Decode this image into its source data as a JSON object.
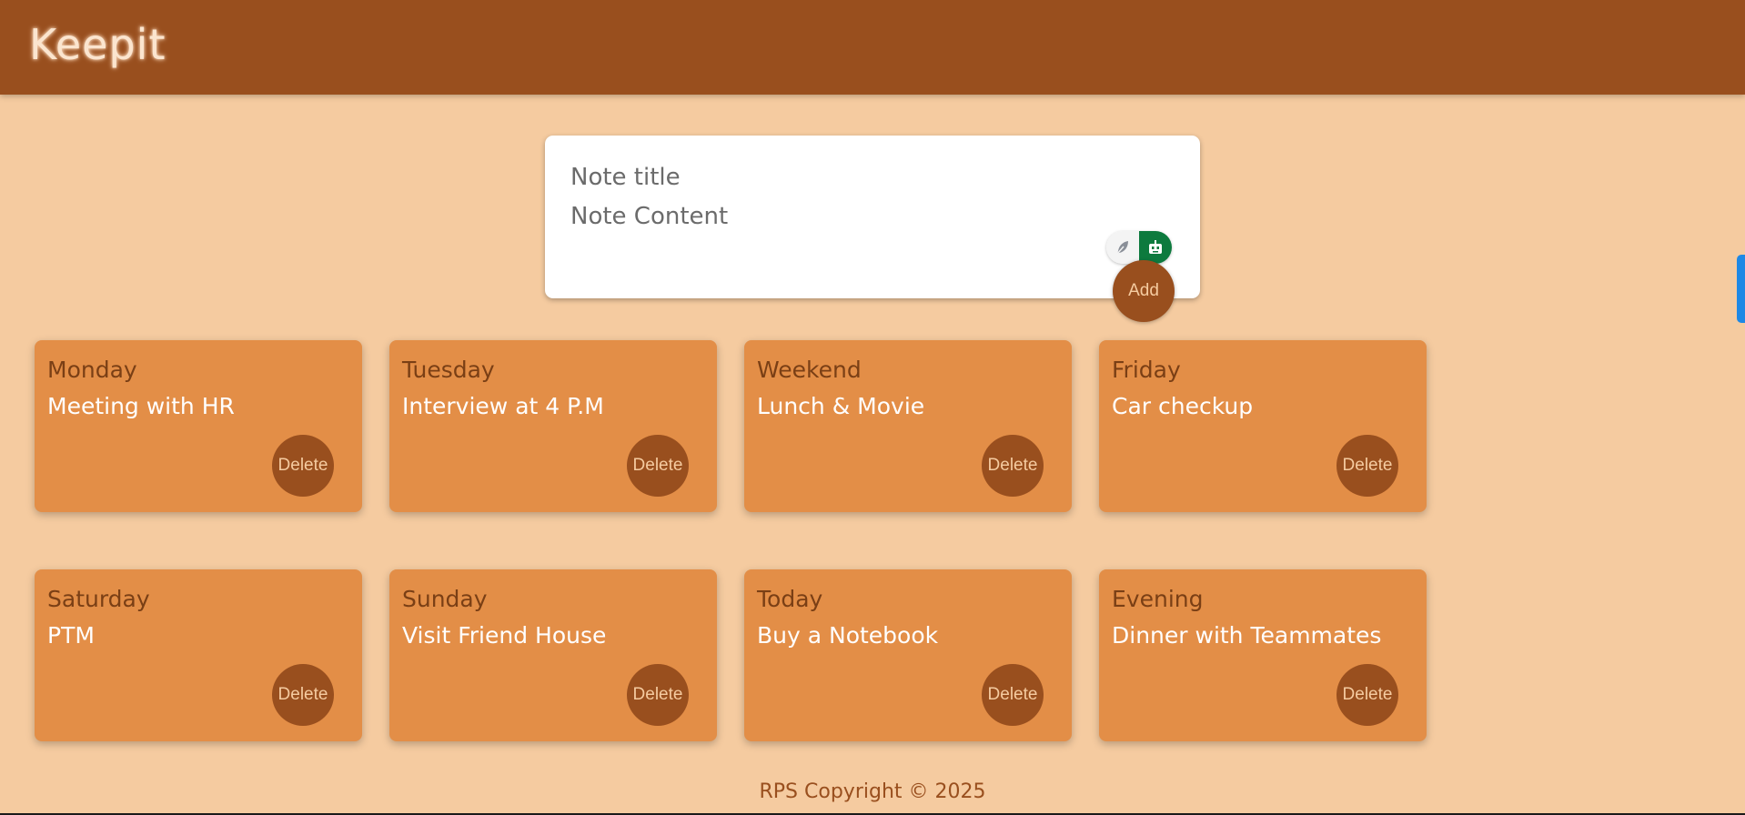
{
  "header": {
    "title": "Keepit"
  },
  "compose": {
    "title_placeholder": "Note title",
    "content_placeholder": "Note Content",
    "add_label": "Add"
  },
  "notes": [
    {
      "title": "Monday",
      "content": "Meeting with HR",
      "delete_label": "Delete"
    },
    {
      "title": "Tuesday",
      "content": "Interview at 4 P.M",
      "delete_label": "Delete"
    },
    {
      "title": "Weekend",
      "content": "Lunch & Movie",
      "delete_label": "Delete"
    },
    {
      "title": "Friday",
      "content": "Car checkup",
      "delete_label": "Delete"
    },
    {
      "title": "Saturday",
      "content": "PTM",
      "delete_label": "Delete"
    },
    {
      "title": "Sunday",
      "content": "Visit Friend House",
      "delete_label": "Delete"
    },
    {
      "title": "Today",
      "content": "Buy a Notebook",
      "delete_label": "Delete"
    },
    {
      "title": "Evening",
      "content": "Dinner with Teammates",
      "delete_label": "Delete"
    }
  ],
  "footer": {
    "text": "RPS Copyright © 2025"
  },
  "icons": {
    "extension_left": "feather-icon",
    "extension_right": "robot-icon"
  },
  "colors": {
    "header_bg": "#994f1e",
    "page_bg": "#f5cba0",
    "note_bg": "#e38e47",
    "note_title": "#7a3f15",
    "button_bg": "#994f1e",
    "extension_green": "#0d7a3e",
    "side_tab": "#1e88e5"
  }
}
